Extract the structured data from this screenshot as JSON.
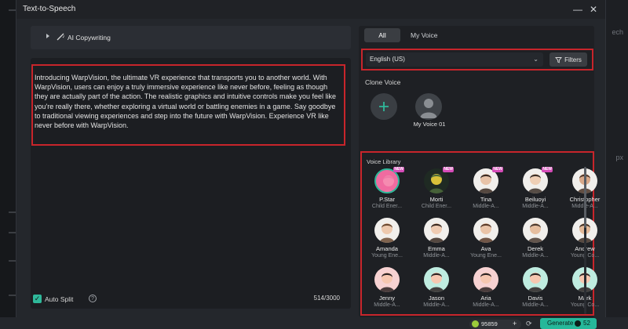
{
  "window": {
    "title": "Text-to-Speech",
    "minimize": "—",
    "close": "✕"
  },
  "background": {
    "right_label_1": "ech",
    "right_label_2": "px"
  },
  "copywriting": {
    "label": "AI Copywriting"
  },
  "editor": {
    "text": "Introducing WarpVision, the ultimate VR experience that transports you to another world. With WarpVision, users can enjoy a truly immersive experience like never before, feeling as though they are actually part of the action. The realistic graphics and intuitive controls make you feel like you're really there, whether exploring a virtual world or battling enemies in a game. Say goodbye to traditional viewing experiences and step into the future with WarpVision. Experience VR like never before with WarpVision.",
    "auto_split_label": "Auto Split",
    "char_count": "514/3000"
  },
  "tabs": {
    "all": "All",
    "my_voice": "My Voice"
  },
  "language": {
    "selected": "English (US)",
    "filters_label": "Filters"
  },
  "clone": {
    "title": "Clone Voice",
    "my_voice_name": "My Voice 01"
  },
  "library": {
    "title": "Voice Library",
    "voices": [
      {
        "name": "P.Star",
        "desc": "Child Ener...",
        "new": "NEW",
        "bg": "#f06ba0",
        "skin": "#f58bb0",
        "hair": "#ef7aa7",
        "selected": true
      },
      {
        "name": "Morti",
        "desc": "Child Ener...",
        "new": "NEW",
        "bg": "#1f2a23",
        "skin": "#d9c13a",
        "hair": "#4d6b3c",
        "selected": false
      },
      {
        "name": "Tina",
        "desc": "Middle-A...",
        "new": "NEW",
        "bg": "#f1efec",
        "skin": "#e8c3a8",
        "hair": "#3a2a22",
        "selected": false
      },
      {
        "name": "Beiluoyi",
        "desc": "Middle-A...",
        "new": "NEW",
        "bg": "#f1efec",
        "skin": "#efcfb5",
        "hair": "#3b2f28",
        "selected": false
      },
      {
        "name": "Christopher",
        "desc": "Middle-A...",
        "new": "",
        "bg": "#f1efec",
        "skin": "#d9a98a",
        "hair": "#4a3326",
        "selected": false
      },
      {
        "name": "Amanda",
        "desc": "Young Ene...",
        "new": "",
        "bg": "#f1efec",
        "skin": "#edc9ae",
        "hair": "#6b4a32",
        "selected": false
      },
      {
        "name": "Emma",
        "desc": "Middle-A...",
        "new": "",
        "bg": "#f1efec",
        "skin": "#efcbb2",
        "hair": "#3a2a22",
        "selected": false
      },
      {
        "name": "Ava",
        "desc": "Young Ene...",
        "new": "",
        "bg": "#f1efec",
        "skin": "#eac4a8",
        "hair": "#5a3b2a",
        "selected": false
      },
      {
        "name": "Derek",
        "desc": "Middle-A...",
        "new": "",
        "bg": "#f1efec",
        "skin": "#e6be9f",
        "hair": "#4a3a30",
        "selected": false
      },
      {
        "name": "Andrew",
        "desc": "Young Co...",
        "new": "",
        "bg": "#f1efec",
        "skin": "#e3b998",
        "hair": "#3c2c22",
        "selected": false
      },
      {
        "name": "Jenny",
        "desc": "Middle-A...",
        "new": "",
        "bg": "#f7d2d2",
        "skin": "#f6c7b0",
        "hair": "#2b2222",
        "selected": false
      },
      {
        "name": "Jason",
        "desc": "Middle-A...",
        "new": "",
        "bg": "#bfece0",
        "skin": "#f6c7b0",
        "hair": "#2b2222",
        "selected": false
      },
      {
        "name": "Aria",
        "desc": "Middle-A...",
        "new": "",
        "bg": "#f7d2d2",
        "skin": "#f6c7b0",
        "hair": "#2b2222",
        "selected": false
      },
      {
        "name": "Davis",
        "desc": "Middle-A...",
        "new": "",
        "bg": "#bfece0",
        "skin": "#f6c7b0",
        "hair": "#2b2222",
        "selected": false
      },
      {
        "name": "Mark",
        "desc": "Young Co...",
        "new": "",
        "bg": "#bfece0",
        "skin": "#f6c7b0",
        "hair": "#2b2222",
        "selected": false
      }
    ]
  },
  "footer": {
    "credits": "95859",
    "generate_label": "Generate",
    "generate_cost": "52"
  },
  "colors": {
    "accent": "#2fb89a",
    "highlight": "#c8252b",
    "new_badge": "#d54bb8"
  }
}
